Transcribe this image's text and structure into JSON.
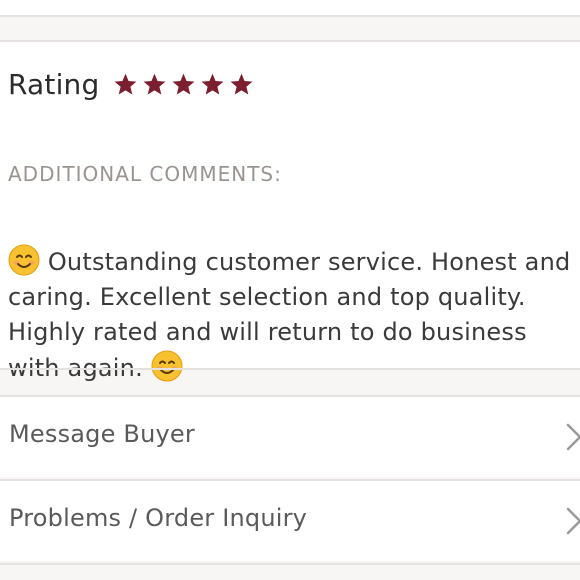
{
  "rating": {
    "label": "Rating",
    "stars_filled": 5,
    "stars_total": 5,
    "star_color": "#7b1f2f"
  },
  "comments": {
    "heading": "ADDITIONAL COMMENTS:",
    "text": "Outstanding customer service. Honest and caring. Excellent selection and top quality. Highly rated and will return to do business with again.",
    "emoji": "smiling-face-emoji"
  },
  "actions": [
    {
      "label": "Message Buyer",
      "icon": "chevron-right-icon"
    },
    {
      "label": "Problems / Order Inquiry",
      "icon": "chevron-right-icon"
    }
  ]
}
